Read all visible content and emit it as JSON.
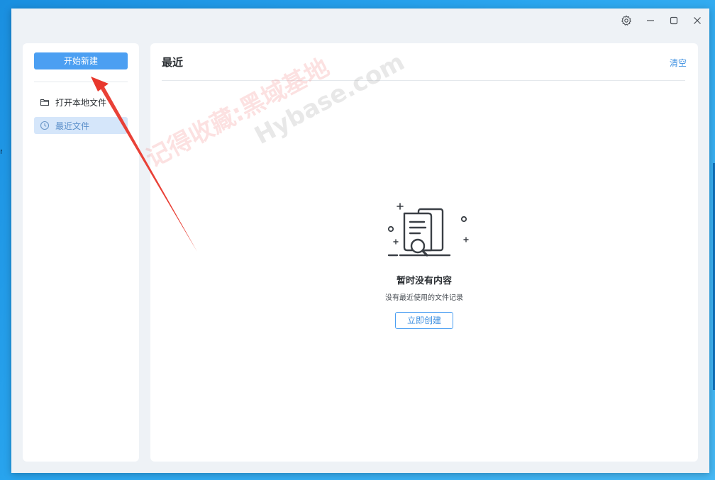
{
  "desktop": {
    "edge_text": "n"
  },
  "titlebar": {
    "settings_icon": "gear-icon",
    "minimize_icon": "minimize-icon",
    "maximize_icon": "maximize-icon",
    "close_icon": "close-icon"
  },
  "sidebar": {
    "new_button_label": "开始新建",
    "items": [
      {
        "label": "打开本地文件",
        "icon": "folder-icon",
        "active": false
      },
      {
        "label": "最近文件",
        "icon": "clock-icon",
        "active": true
      }
    ]
  },
  "main": {
    "title": "最近",
    "clear_label": "清空",
    "empty": {
      "illustration": "document-search-icon",
      "title": "暂时没有内容",
      "subtitle": "没有最近使用的文件记录",
      "create_label": "立即创建"
    }
  },
  "watermark": {
    "line1_red": "记得收藏:黑域基地",
    "line1_grey": "Hybase.com"
  },
  "colors": {
    "accent": "#4b9ff2",
    "link": "#3d8fe0",
    "active_bg": "#d5e6fa",
    "annotation_arrow": "#e8372c"
  }
}
